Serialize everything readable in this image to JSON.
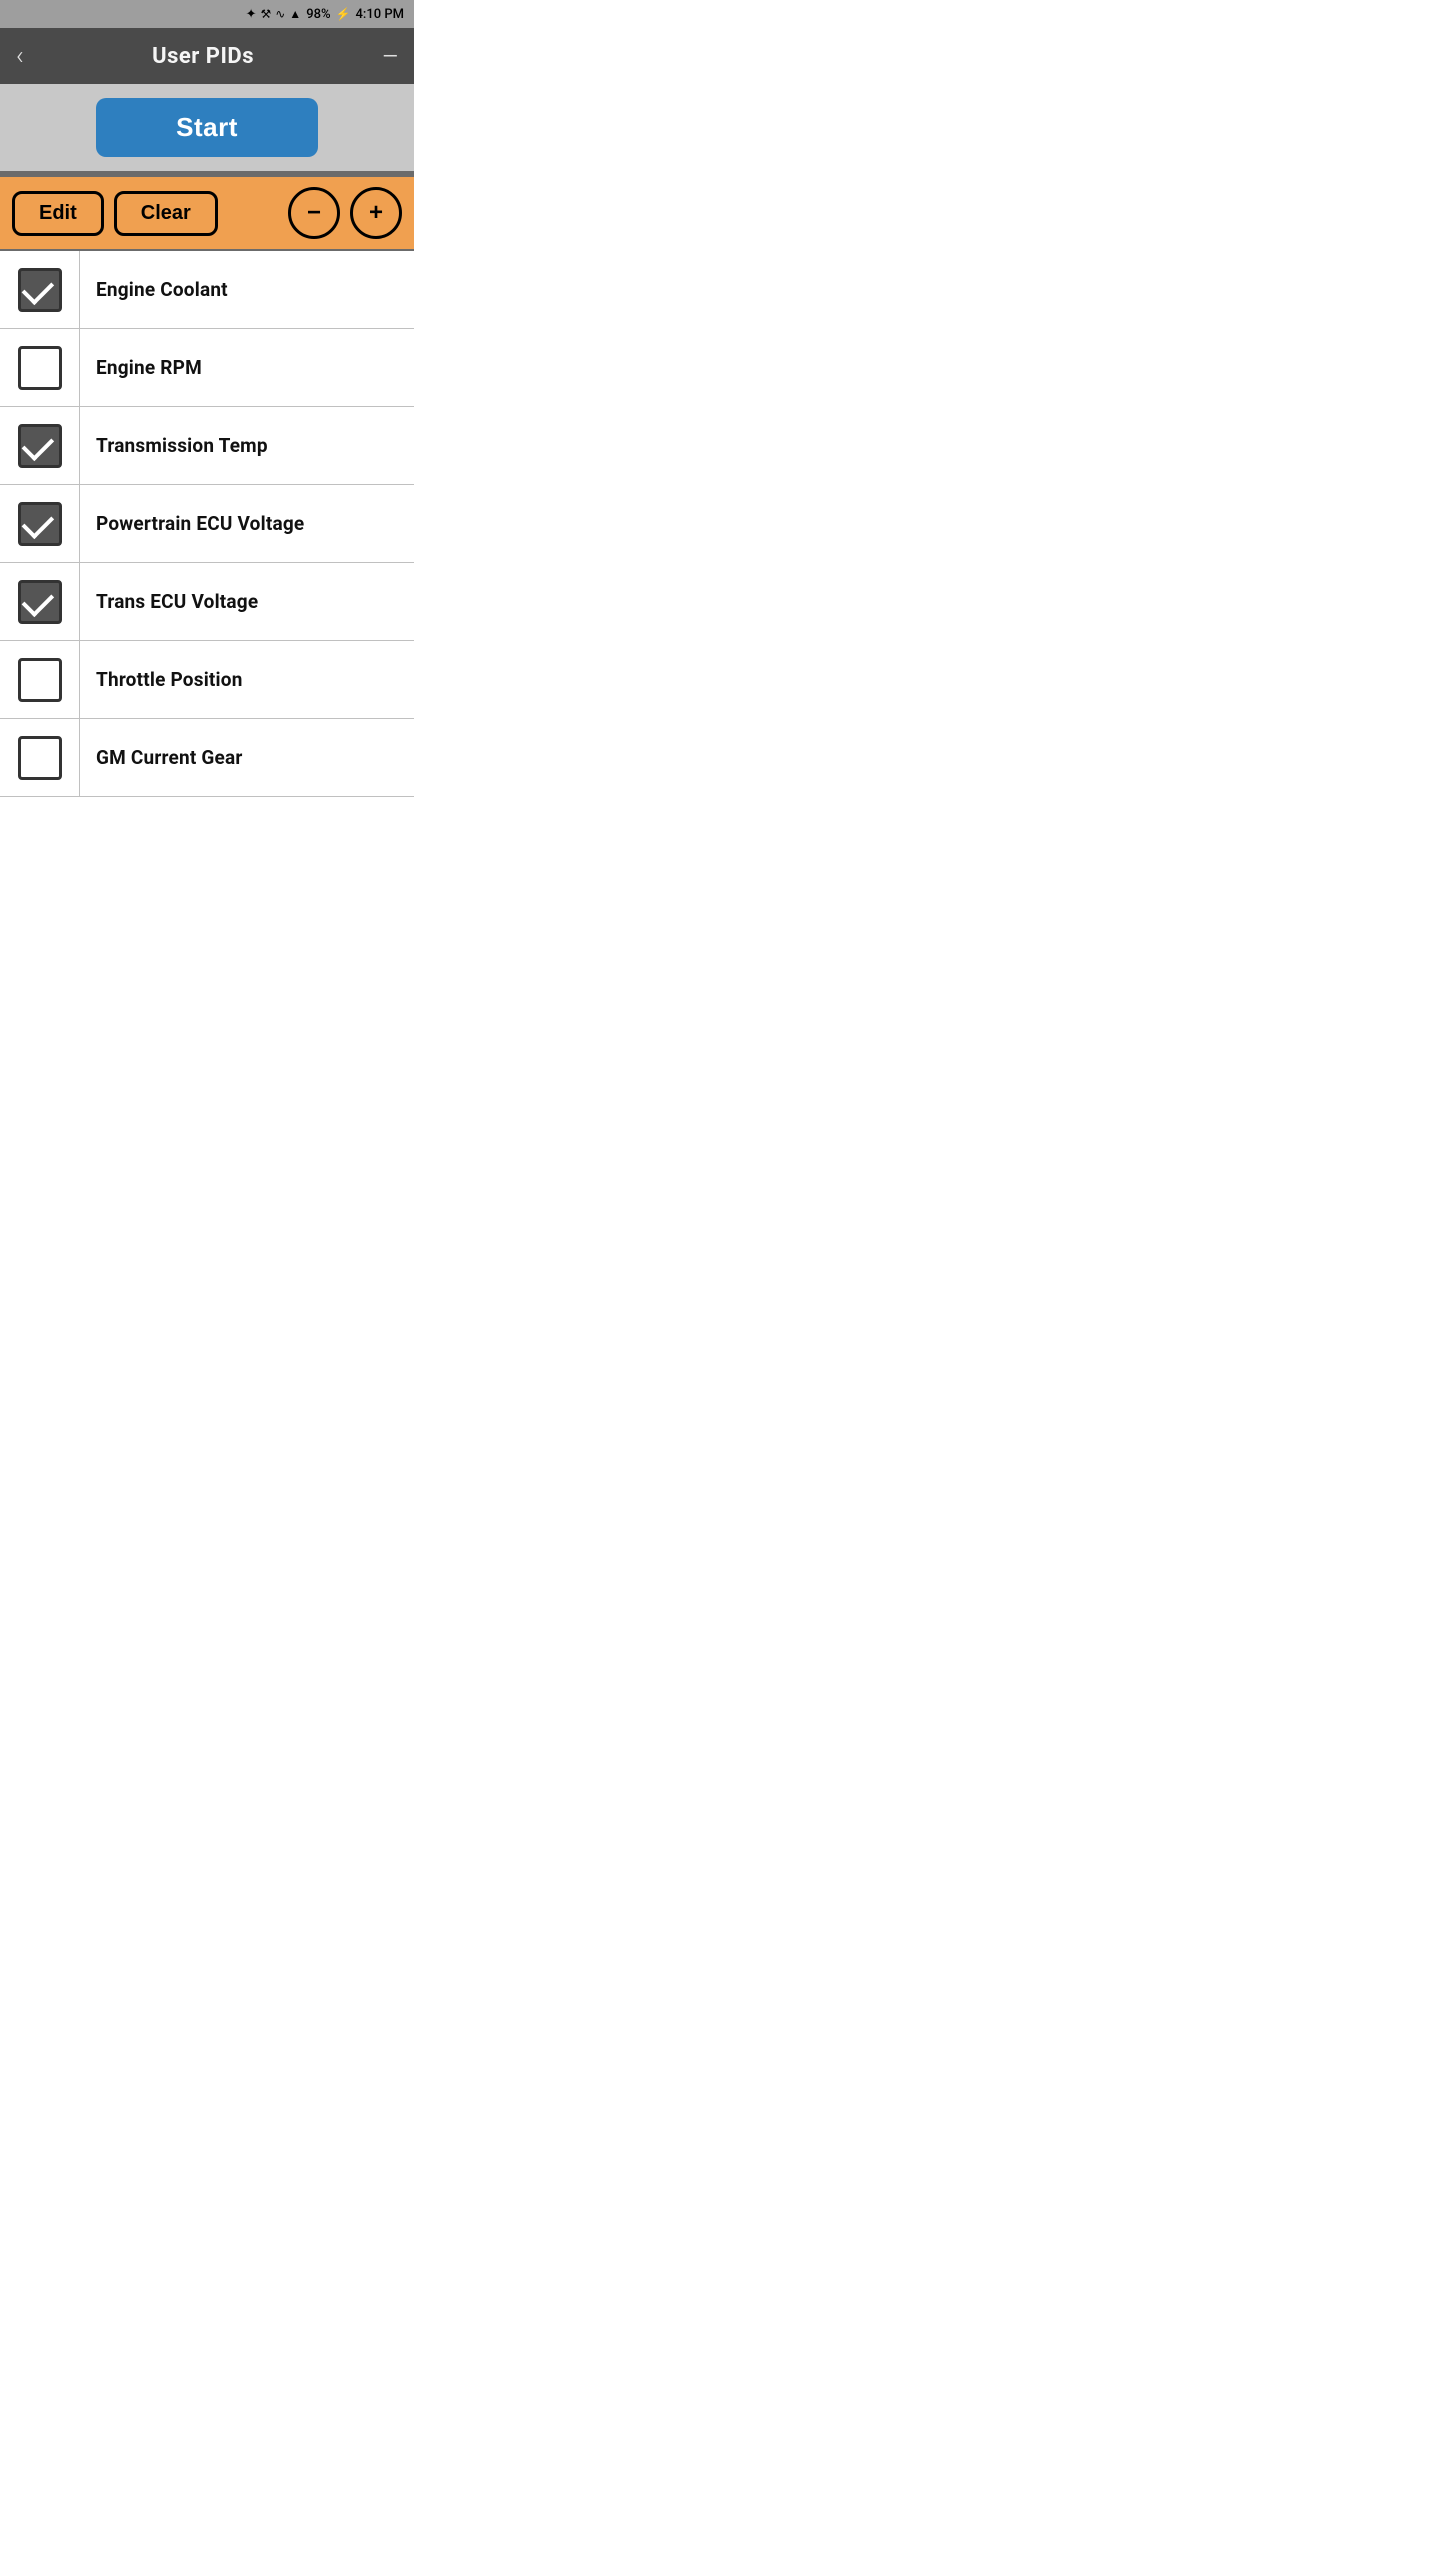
{
  "statusBar": {
    "battery": "98%",
    "time": "4:10 PM"
  },
  "header": {
    "backLabel": "‹",
    "title": "User PIDs",
    "menuLabel": "—"
  },
  "startButton": {
    "label": "Start"
  },
  "toolbar": {
    "editLabel": "Edit",
    "clearLabel": "Clear",
    "minusLabel": "−",
    "plusLabel": "+"
  },
  "pidItems": [
    {
      "label": "Engine Coolant",
      "checked": true
    },
    {
      "label": "Engine RPM",
      "checked": false
    },
    {
      "label": "Transmission Temp",
      "checked": true
    },
    {
      "label": "Powertrain ECU Voltage",
      "checked": true
    },
    {
      "label": "Trans ECU Voltage",
      "checked": true
    },
    {
      "label": "Throttle Position",
      "checked": false
    },
    {
      "label": "GM Current Gear",
      "checked": false
    }
  ]
}
